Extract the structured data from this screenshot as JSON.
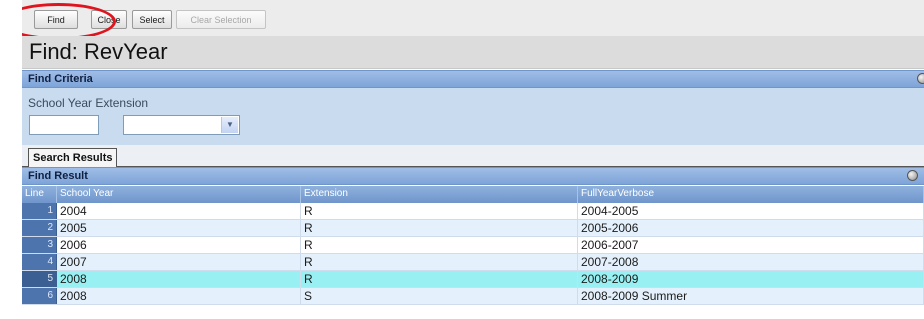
{
  "toolbar": {
    "find_label": "Find",
    "close_label": "Close",
    "select_label": "Select",
    "clear_label": "Clear Selection"
  },
  "page": {
    "title": "Find: RevYear"
  },
  "criteria": {
    "header": "Find Criteria",
    "field_label": "School Year Extension",
    "school_year_value": "",
    "extension_value": ""
  },
  "tabs": [
    {
      "label": "Search Results"
    }
  ],
  "results": {
    "header": "Find Result",
    "columns": [
      "Line",
      "School Year",
      "Extension",
      "FullYearVerbose"
    ],
    "rows": [
      {
        "line": "1",
        "school_year": "2004",
        "extension": "R",
        "full": "2004-2005"
      },
      {
        "line": "2",
        "school_year": "2005",
        "extension": "R",
        "full": "2005-2006"
      },
      {
        "line": "3",
        "school_year": "2006",
        "extension": "R",
        "full": "2006-2007"
      },
      {
        "line": "4",
        "school_year": "2007",
        "extension": "R",
        "full": "2007-2008"
      },
      {
        "line": "5",
        "school_year": "2008",
        "extension": "R",
        "full": "2008-2009"
      },
      {
        "line": "6",
        "school_year": "2008",
        "extension": "S",
        "full": "2008-2009 Summer"
      }
    ],
    "selected_line": "5"
  },
  "colors": {
    "highlight_ring": "#e0141e",
    "section_header": "#7ea4d8",
    "criteria_bg": "#c9dcef",
    "selected_row": "#99f0f2",
    "row_alt": "#e4f1fc"
  },
  "icons": [
    "collapse-circle-icon",
    "dropdown-arrow-icon"
  ]
}
